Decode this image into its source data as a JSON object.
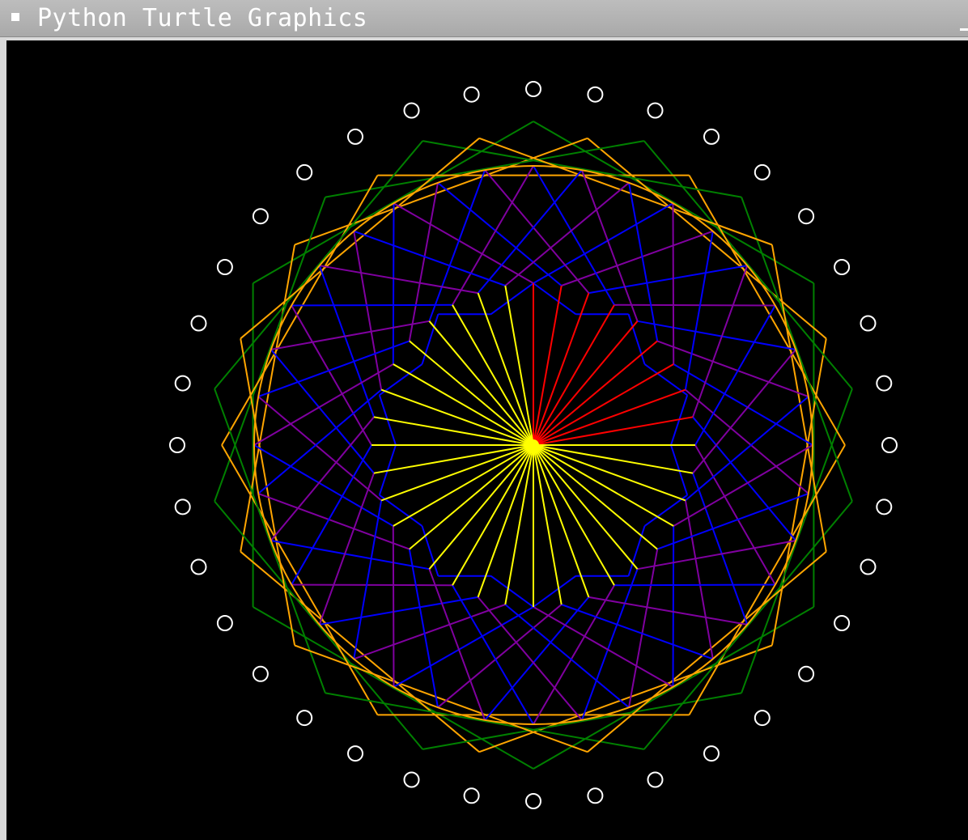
{
  "window": {
    "title": "Python Turtle Graphics",
    "menu_icon": "window-menu-icon",
    "minimize_icon": "minimize-icon"
  },
  "canvas": {
    "background": "#000000",
    "colors": {
      "red": "#ff0000",
      "yellow": "#ffff00",
      "blue": "#0000ff",
      "purple": "#8000a0",
      "green": "#008000",
      "orange": "#ffa500",
      "marker": "#ffffff"
    }
  }
}
